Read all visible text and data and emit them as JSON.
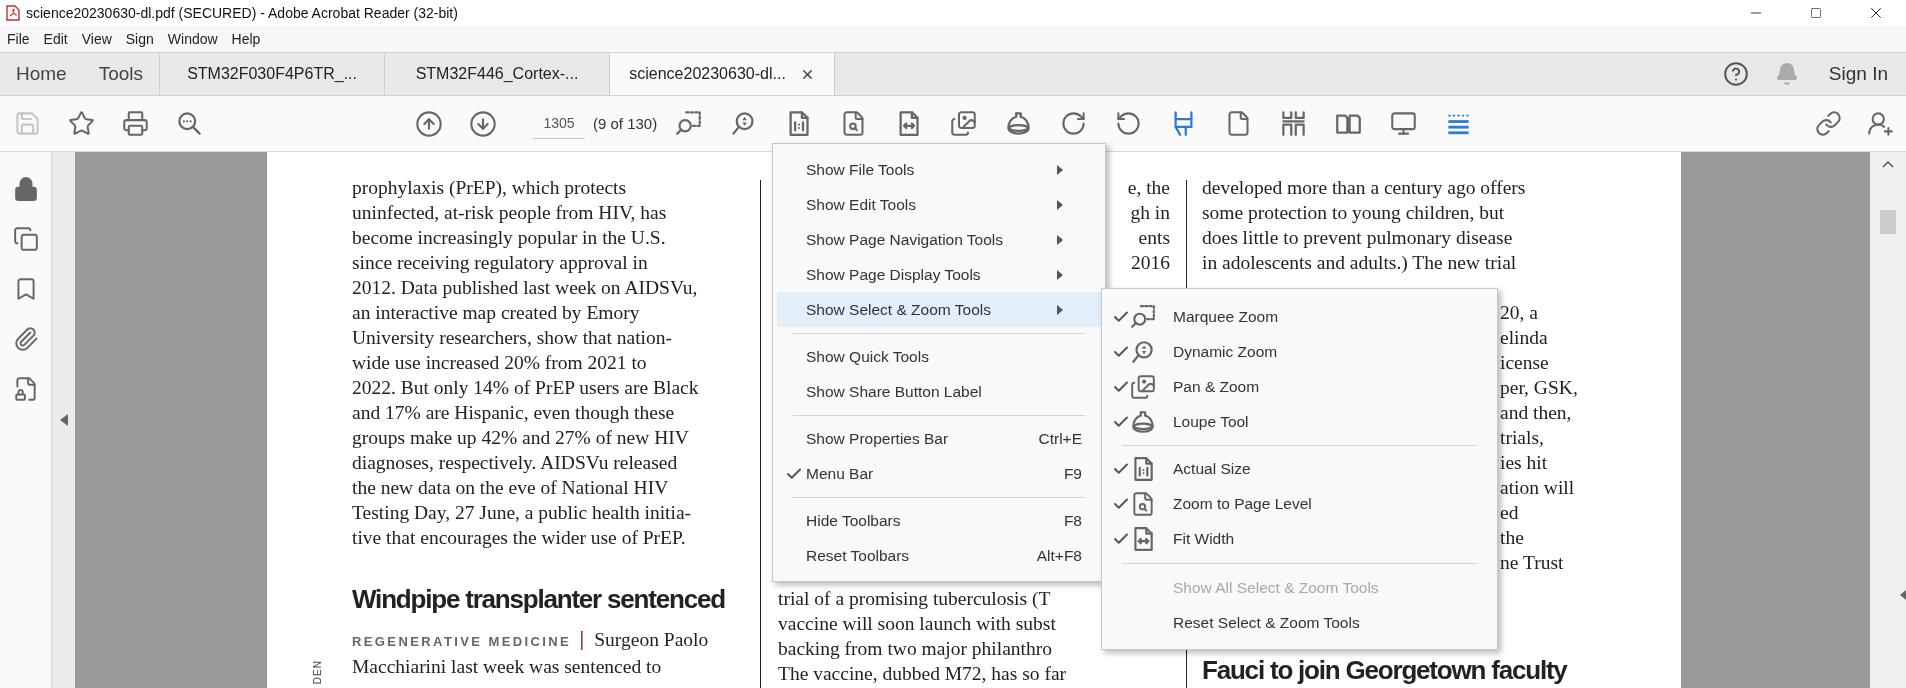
{
  "window": {
    "title": "science20230630-dl.pdf (SECURED) - Adobe Acrobat Reader (32-bit)"
  },
  "menu_bar": [
    "File",
    "Edit",
    "View",
    "Sign",
    "Window",
    "Help"
  ],
  "tabs": [
    {
      "label": "Home",
      "kind": "nav",
      "selected": false
    },
    {
      "label": "Tools",
      "kind": "nav",
      "selected": false
    },
    {
      "label": "STM32F030F4P6TR_...",
      "kind": "document",
      "selected": false
    },
    {
      "label": "STM32F446_Cortex-...",
      "kind": "document",
      "selected": false
    },
    {
      "label": "science20230630-dl...",
      "kind": "document",
      "selected": true
    }
  ],
  "sign_in": "Sign In",
  "toolbar": {
    "left": [
      {
        "kind": "save",
        "disabled": true
      },
      {
        "kind": "bookmark",
        "disabled": false
      },
      {
        "kind": "print",
        "disabled": false
      },
      {
        "kind": "find",
        "disabled": false
      }
    ],
    "nav": [
      {
        "kind": "prev-page",
        "disabled": false
      },
      {
        "kind": "next-page",
        "disabled": false
      }
    ],
    "page_field": {
      "value": "1305"
    },
    "page_count": "(9 of 130)",
    "tools": [
      {
        "kind": "marquee-zoom",
        "active": false
      },
      {
        "kind": "dynamic-zoom",
        "active": false
      },
      {
        "kind": "actual-size",
        "active": false
      },
      {
        "kind": "zoom-page",
        "active": false
      },
      {
        "kind": "fit-width",
        "active": false
      },
      {
        "kind": "pan-zoom",
        "active": false
      },
      {
        "kind": "loupe",
        "active": false
      },
      {
        "kind": "rotate-cw",
        "active": false
      },
      {
        "kind": "rotate-ccw",
        "active": false
      },
      {
        "kind": "read-mode",
        "active": true
      },
      {
        "kind": "single-page",
        "active": false
      },
      {
        "kind": "scrolling",
        "active": false
      },
      {
        "kind": "two-page",
        "active": false
      },
      {
        "kind": "presentation",
        "active": false
      },
      {
        "kind": "lines",
        "active": true
      }
    ]
  },
  "document": {
    "credit": "DEN",
    "column_1": {
      "paragraph": [
        "prophylaxis (PrEP), which protects",
        "uninfected, at-risk people from HIV, has",
        "become increasingly popular in the U.S.",
        "since receiving regulatory approval in",
        "2012. Data published last week on AIDSVu,",
        "an interactive map created by Emory",
        "University researchers, show that nation-",
        "wide use increased 20% from 2021 to",
        "2022. But only 14% of PrEP users are Black",
        "and 17% are Hispanic, even though these",
        "groups make up 42% and 27% of new HIV",
        "diagnoses, respectively. AIDSVu released",
        "the new data on the eve of National HIV",
        "Testing Day, 27 June, a public health initia-",
        "tive that encourages the wider use of PrEP."
      ],
      "heading": "Windpipe transplanter sentenced",
      "kicker": "REGENERATIVE MEDICINE",
      "separator": "|",
      "lead": [
        "Surgeon Paolo",
        "Macchiarini last week was sentenced to"
      ]
    },
    "column_2": {
      "fragments": [
        "e, the",
        "gh in",
        "ents",
        "2016"
      ],
      "lines": [
        "trial of a promising tuberculosis (T",
        "vaccine will soon launch with subst",
        "backing from two major philanthro",
        "The vaccine, dubbed M72, has so far"
      ]
    },
    "column_3": {
      "lines": [
        "developed more than a century ago offers",
        "some protection to young children, but",
        "does little to prevent pulmonary disease",
        "in adolescents and adults.) The new trial"
      ],
      "fragments": [
        "20, a",
        "elinda",
        "icense",
        "per, GSK,",
        "and then,",
        "trials,",
        "ies hit",
        "ation will",
        "ed",
        "the",
        "ne Trust"
      ],
      "heading": "Fauci to join Georgetown faculty"
    }
  },
  "context_menu": {
    "groups": [
      [
        {
          "label": "Show File Tools",
          "kind": "submenu",
          "checked": false,
          "selected": false
        },
        {
          "label": "Show Edit Tools",
          "kind": "submenu",
          "checked": false,
          "selected": false
        },
        {
          "label": "Show Page Navigation Tools",
          "kind": "submenu",
          "checked": false,
          "selected": false
        },
        {
          "label": "Show Page Display Tools",
          "kind": "submenu",
          "checked": false,
          "selected": false
        },
        {
          "label": "Show Select & Zoom Tools",
          "kind": "submenu",
          "checked": false,
          "selected": true
        }
      ],
      [
        {
          "label": "Show Quick Tools",
          "kind": "command",
          "checked": false,
          "selected": false
        },
        {
          "label": "Show Share Button Label",
          "kind": "command",
          "checked": false,
          "selected": false
        }
      ],
      [
        {
          "label": "Show Properties Bar",
          "kind": "command",
          "shortcut": "Ctrl+E",
          "checked": false,
          "selected": false
        },
        {
          "label": "Menu Bar",
          "kind": "command",
          "shortcut": "F9",
          "checked": true,
          "selected": false
        }
      ],
      [
        {
          "label": "Hide Toolbars",
          "kind": "command",
          "shortcut": "F8",
          "checked": false,
          "selected": false
        },
        {
          "label": "Reset Toolbars",
          "kind": "command",
          "shortcut": "Alt+F8",
          "checked": false,
          "selected": false
        }
      ]
    ]
  },
  "submenu": {
    "groups": [
      [
        {
          "label": "Marquee Zoom",
          "kind": "marquee-zoom",
          "checked": true,
          "disabled": false
        },
        {
          "label": "Dynamic Zoom",
          "kind": "dynamic-zoom",
          "checked": true,
          "disabled": false
        },
        {
          "label": "Pan & Zoom",
          "kind": "pan-zoom",
          "checked": true,
          "disabled": false
        },
        {
          "label": "Loupe Tool",
          "kind": "loupe",
          "checked": true,
          "disabled": false
        }
      ],
      [
        {
          "label": "Actual Size",
          "kind": "actual-size",
          "checked": true,
          "disabled": false
        },
        {
          "label": "Zoom to Page Level",
          "kind": "zoom-page",
          "checked": true,
          "disabled": false
        },
        {
          "label": "Fit Width",
          "kind": "fit-width",
          "checked": true,
          "disabled": false
        }
      ],
      [
        {
          "label": "Show All Select & Zoom Tools",
          "kind": "command",
          "checked": false,
          "disabled": true
        },
        {
          "label": "Reset Select & Zoom Tools",
          "kind": "command",
          "checked": false,
          "disabled": false
        }
      ]
    ]
  }
}
